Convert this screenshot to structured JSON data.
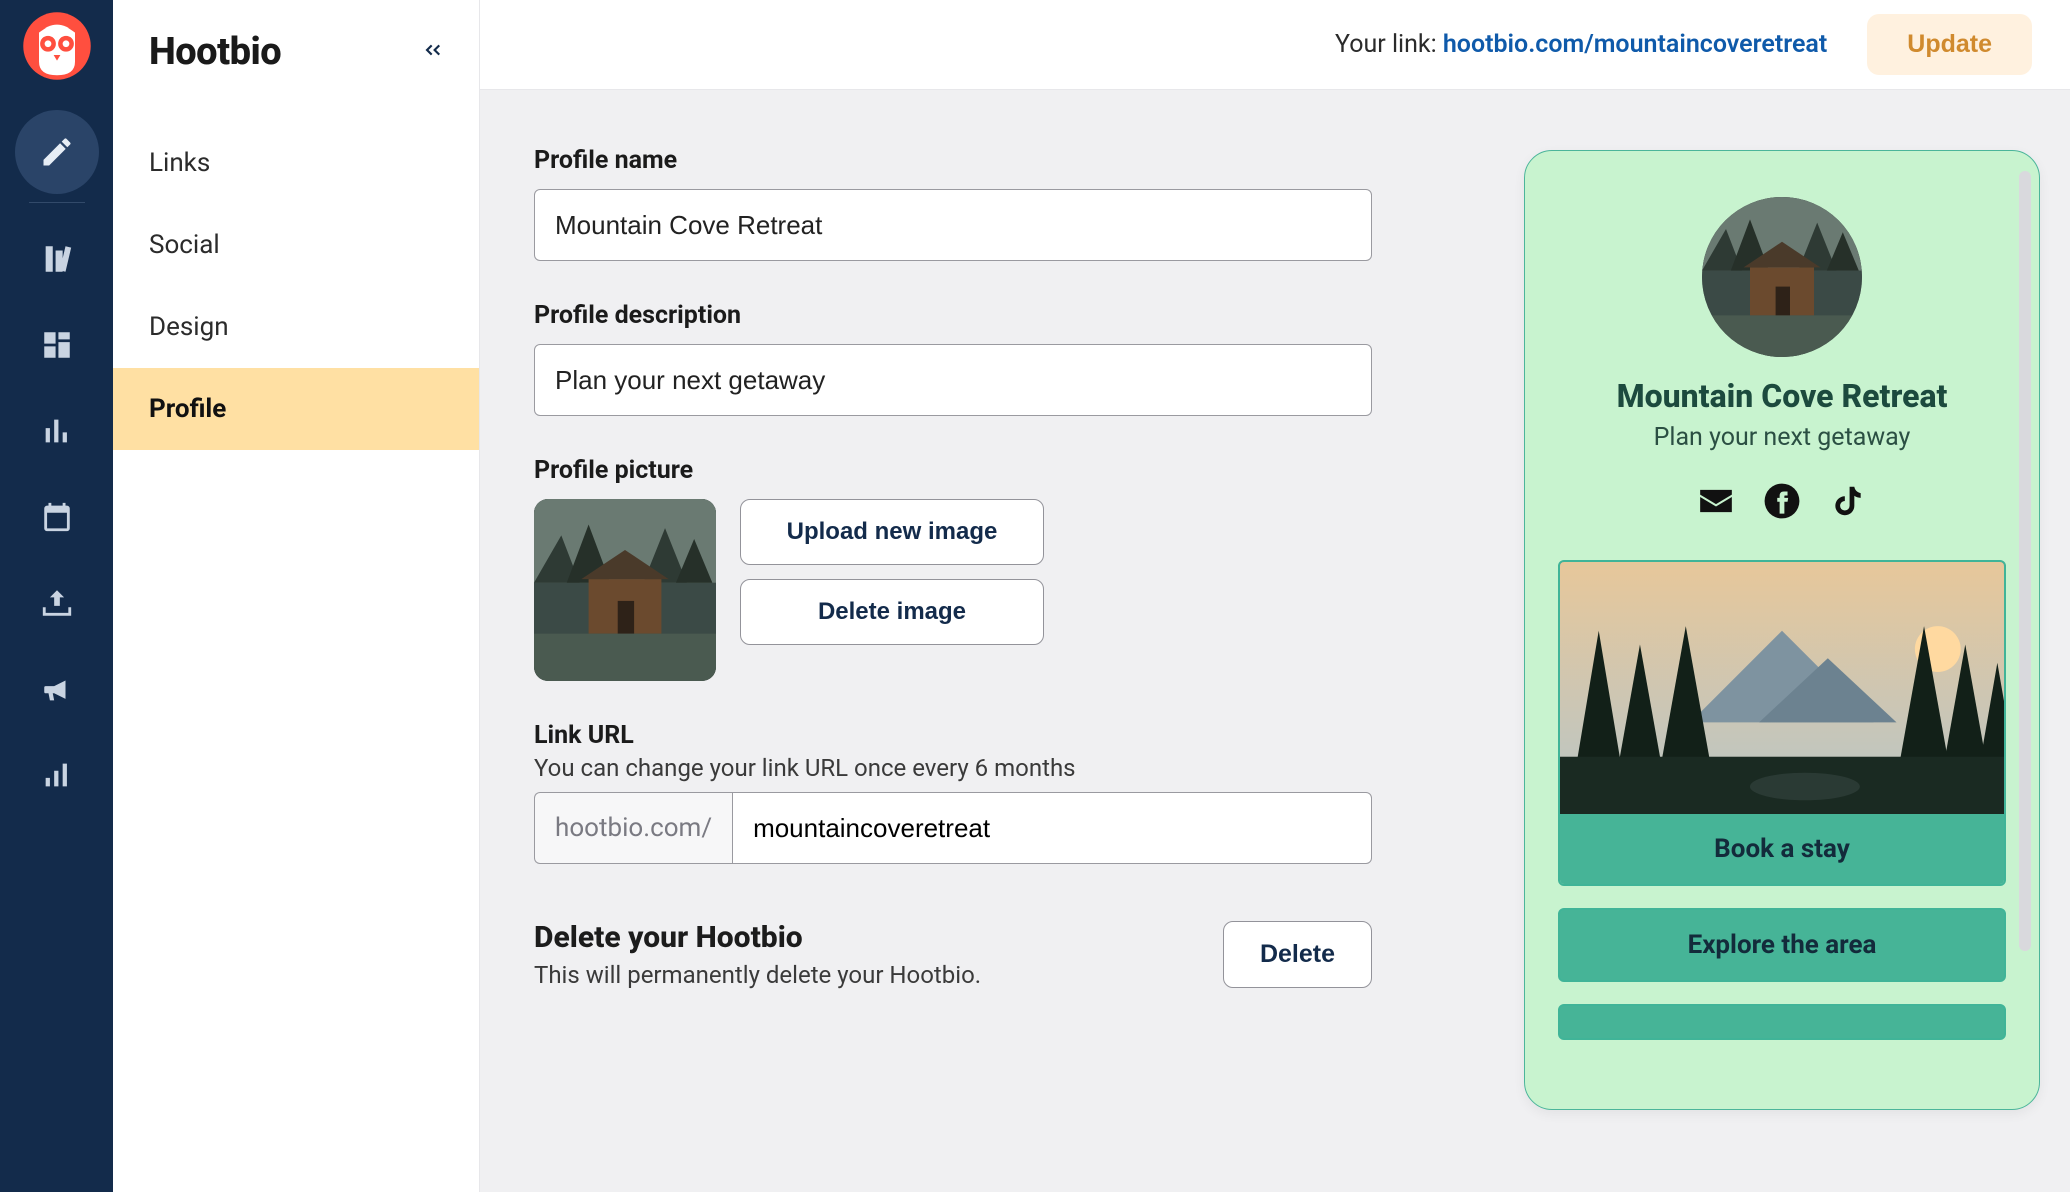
{
  "brand": "Hootbio",
  "topbar": {
    "your_link_label": "Your link:",
    "your_link_url": "hootbio.com/mountaincoveretreat",
    "update_label": "Update"
  },
  "sidebar": {
    "items": [
      {
        "label": "Links"
      },
      {
        "label": "Social"
      },
      {
        "label": "Design"
      },
      {
        "label": "Profile"
      }
    ],
    "active_index": 3
  },
  "form": {
    "profile_name": {
      "label": "Profile name",
      "value": "Mountain Cove Retreat"
    },
    "profile_description": {
      "label": "Profile description",
      "value": "Plan your next getaway"
    },
    "profile_picture": {
      "label": "Profile picture",
      "upload_label": "Upload new image",
      "delete_label": "Delete image"
    },
    "link_url": {
      "label": "Link URL",
      "help": "You can change your link URL once every 6 months",
      "prefix": "hootbio.com/",
      "value": "mountaincoveretreat"
    },
    "delete_section": {
      "title": "Delete your Hootbio",
      "desc": "This will permanently delete your Hootbio.",
      "button": "Delete"
    }
  },
  "preview": {
    "title": "Mountain Cove Retreat",
    "subtitle": "Plan your next getaway",
    "social": [
      "email-icon",
      "facebook-icon",
      "tiktok-icon"
    ],
    "links": [
      {
        "label": "Book a stay",
        "has_image": true
      },
      {
        "label": "Explore the area",
        "has_image": false
      }
    ]
  },
  "colors": {
    "nav_bg": "#132b4b",
    "active_tab_bg": "#ffe0a3",
    "preview_bg": "#c8f3cf",
    "preview_accent": "#46b497",
    "link_color": "#0f5aaa"
  },
  "rail_icons": [
    "edit-icon",
    "library-icon",
    "grid-icon",
    "bar-chart-icon",
    "calendar-icon",
    "inbox-download-icon",
    "megaphone-icon",
    "analytics-icon"
  ]
}
